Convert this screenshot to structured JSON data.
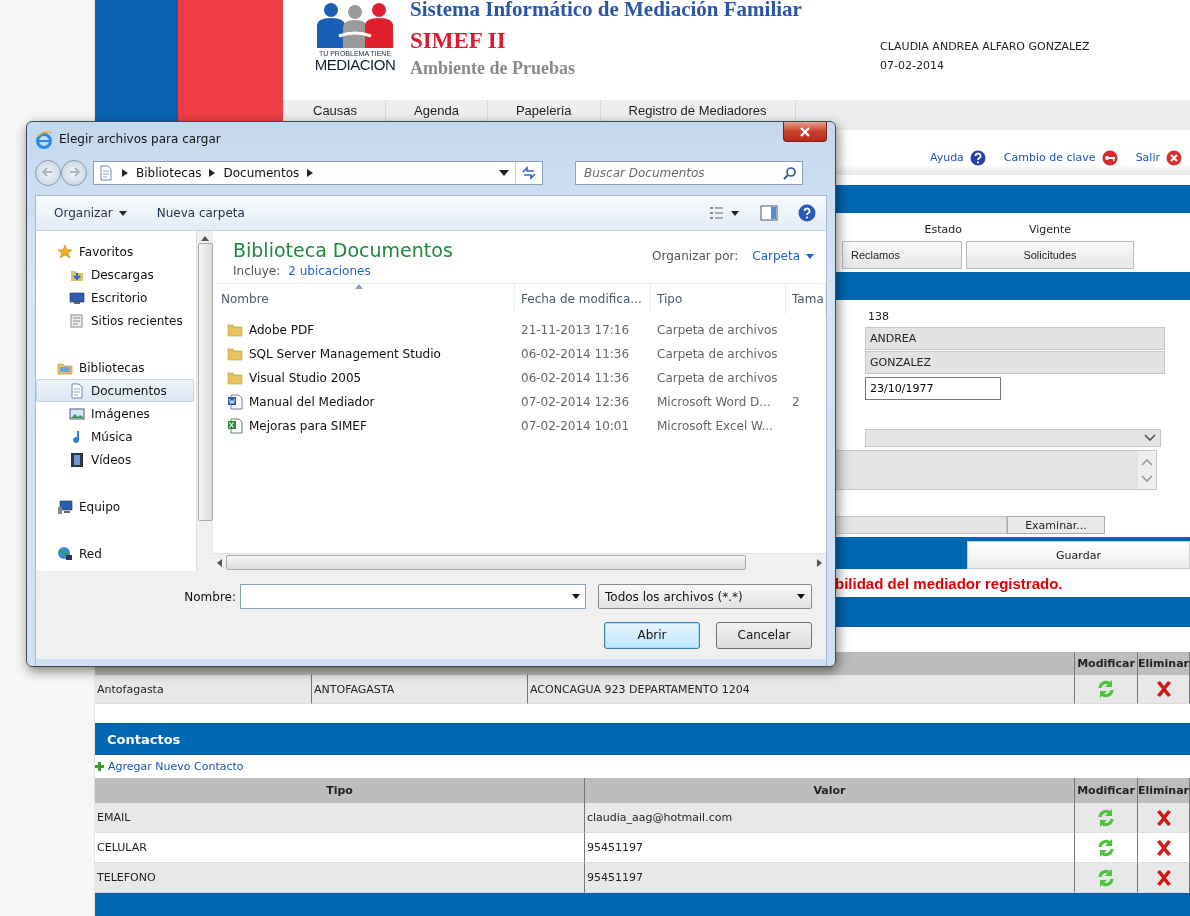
{
  "header": {
    "system_title": "Sistema Informático de Mediación Familiar",
    "app_name": "SIMEF II",
    "environment": "Ambiente de Pruebas",
    "logo_tagline": "TU PROBLEMA TIENE",
    "logo_word": "MEDIACION",
    "user_name": "CLAUDIA ANDREA ALFARO GONZALEZ",
    "date": "07-02-2014"
  },
  "menu": [
    "Causas",
    "Agenda",
    "Papelería",
    "Registro de Mediadores"
  ],
  "user_links": [
    {
      "label": "Ayuda",
      "kind": "help"
    },
    {
      "label": "Cambio de clave",
      "kind": "key"
    },
    {
      "label": "Salir",
      "kind": "exit"
    }
  ],
  "status_row": {
    "label": "Estado",
    "value": "Vigente"
  },
  "tabs": [
    {
      "label": "Reclamos",
      "selected": false
    },
    {
      "label": "Solicitudes",
      "selected": false
    }
  ],
  "form": {
    "id_value": "138",
    "first_name": "ANDREA",
    "last_name": "GONZALEZ",
    "birth_date": "23/10/1977",
    "browse_button": "Examinar...",
    "save_button": "Guardar",
    "message": "bilidad del mediador registrado."
  },
  "addresses": {
    "columns": [
      "Modificar",
      "Eliminar"
    ],
    "rows": [
      {
        "cells": [
          "Antofagasta",
          "ANTOFAGASTA",
          "ACONCAGUA 923 DEPARTAMENTO 1204"
        ]
      }
    ]
  },
  "contacts": {
    "title": "Contactos",
    "add_link": "Agregar Nuevo Contacto",
    "columns": [
      "Tipo",
      "Valor",
      "Modificar",
      "Eliminar"
    ],
    "rows": [
      {
        "cells": [
          "EMAIL",
          "claudia_aag@hotmail.com"
        ]
      },
      {
        "cells": [
          "CELULAR",
          "95451197"
        ]
      },
      {
        "cells": [
          "TELEFONO",
          "95451197"
        ]
      }
    ]
  },
  "dialog": {
    "title": "Elegir archivos para cargar",
    "breadcrumb": [
      "Bibliotecas",
      "Documentos"
    ],
    "search_placeholder": "Buscar Documentos",
    "toolbar": [
      {
        "label": "Organizar",
        "dropdown": true
      },
      {
        "label": "Nueva carpeta",
        "dropdown": false
      }
    ],
    "nav": [
      {
        "label": "Favoritos",
        "kind": "star",
        "selected": false,
        "children": [
          {
            "label": "Descargas",
            "kind": "downloads",
            "selected": false
          },
          {
            "label": "Escritorio",
            "kind": "desktop",
            "selected": false
          },
          {
            "label": "Sitios recientes",
            "kind": "recent",
            "selected": false
          }
        ]
      },
      {
        "label": "Bibliotecas",
        "kind": "library",
        "selected": false,
        "children": [
          {
            "label": "Documentos",
            "kind": "document",
            "selected": true
          },
          {
            "label": "Imágenes",
            "kind": "pictures",
            "selected": false
          },
          {
            "label": "Música",
            "kind": "music",
            "selected": false
          },
          {
            "label": "Vídeos",
            "kind": "videos",
            "selected": false
          }
        ]
      },
      {
        "label": "Equipo",
        "kind": "computer",
        "selected": false
      },
      {
        "label": "Red",
        "kind": "network",
        "selected": false
      }
    ],
    "library_title": "Biblioteca Documentos",
    "includes_label": "Incluye:",
    "includes_link": "2 ubicaciones",
    "arrange_label": "Organizar por:",
    "arrange_value": "Carpeta",
    "columns": [
      "Nombre",
      "Fecha de modifica...",
      "Tipo",
      "Tama"
    ],
    "files": [
      {
        "name": "Adobe PDF",
        "date": "21-11-2013 17:16",
        "type": "Carpeta de archivos",
        "kind": "folder"
      },
      {
        "name": "SQL Server Management Studio",
        "date": "06-02-2014 11:36",
        "type": "Carpeta de archivos",
        "kind": "folder"
      },
      {
        "name": "Visual Studio 2005",
        "date": "06-02-2014 11:36",
        "type": "Carpeta de archivos",
        "kind": "folder"
      },
      {
        "name": "Manual del Mediador",
        "date": "07-02-2014 12:36",
        "type": "Microsoft Word D...",
        "size": "2",
        "kind": "word"
      },
      {
        "name": "Mejoras para SIMEF",
        "date": "07-02-2014 10:01",
        "type": "Microsoft Excel W...",
        "kind": "excel"
      }
    ],
    "filename_label": "Nombre:",
    "filetype": "Todos los archivos (*.*)",
    "buttons": [
      {
        "label": "Abrir",
        "default": true
      },
      {
        "label": "Cancelar",
        "default": false
      }
    ]
  }
}
